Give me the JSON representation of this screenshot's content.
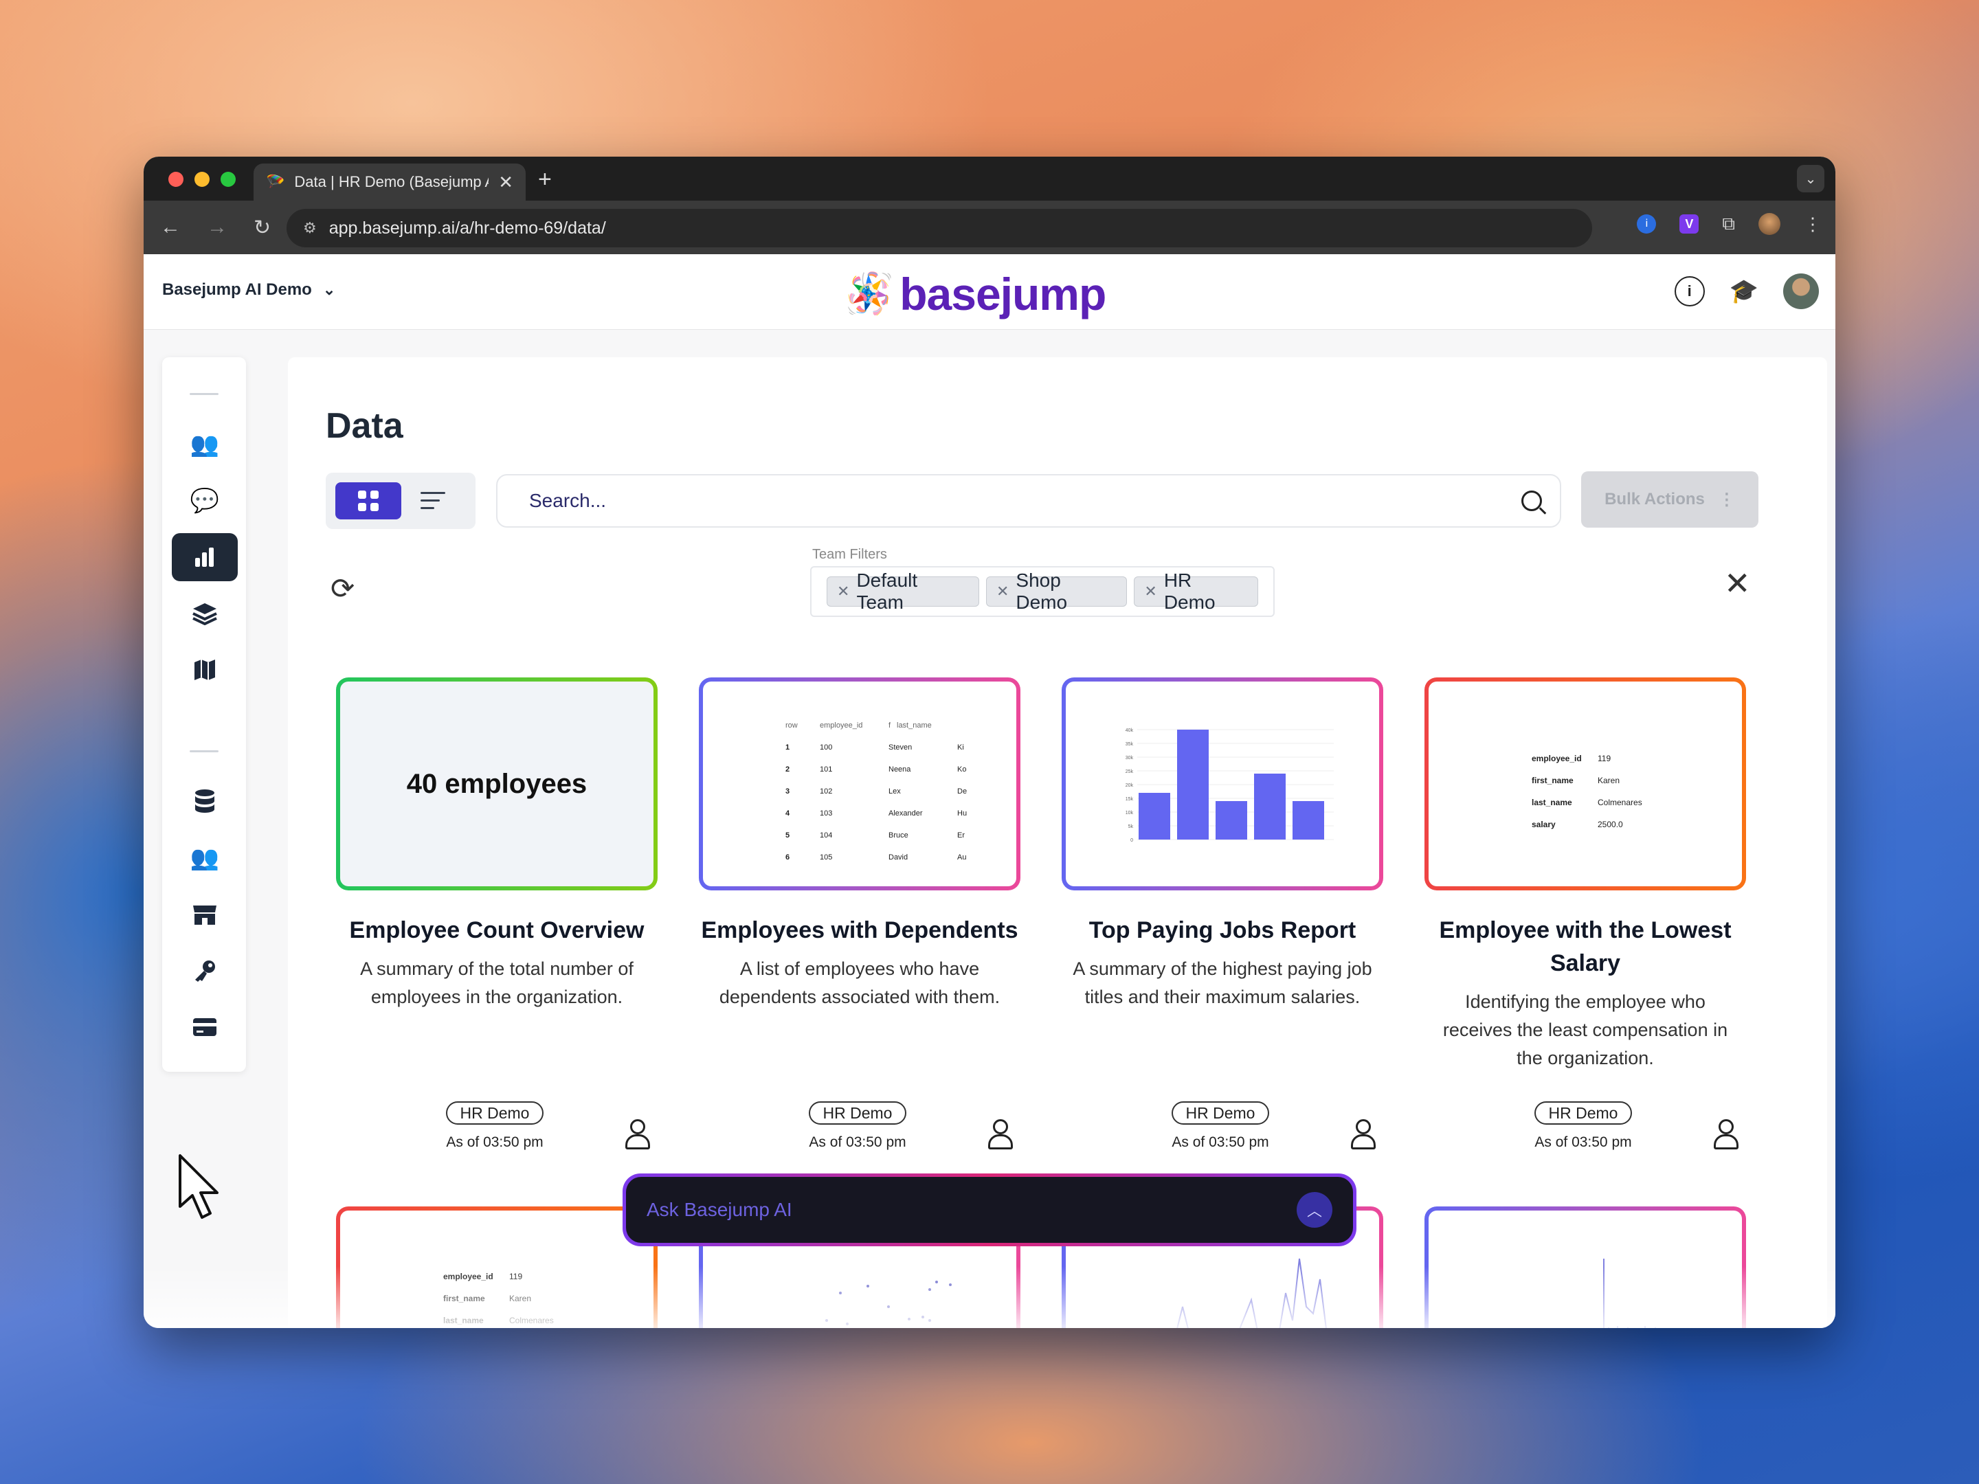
{
  "browser": {
    "tab_title": "Data | HR Demo (Basejump A",
    "tab_favicon": "🪂",
    "url": "app.basejump.ai/a/hr-demo-69/data/",
    "extensions": [
      "password-manager-icon",
      "v-extension-icon",
      "puzzle-icon",
      "profile-avatar",
      "kebab-menu-icon"
    ]
  },
  "header": {
    "workspace": "Basejump AI Demo",
    "logo_text": "basejump",
    "logo_mark": "🪅"
  },
  "sidebar": {
    "items": [
      {
        "name": "teams-icon",
        "glyph": "👥"
      },
      {
        "name": "chat-icon",
        "glyph": "💬"
      },
      {
        "name": "data-icon",
        "glyph": "📊",
        "active": true
      },
      {
        "name": "layers-icon",
        "glyph": "≋"
      },
      {
        "name": "map-icon",
        "glyph": "🗺"
      },
      {
        "name": "database-icon",
        "glyph": "🛢"
      },
      {
        "name": "users-icon",
        "glyph": "👥"
      },
      {
        "name": "store-icon",
        "glyph": "🏪"
      },
      {
        "name": "key-icon",
        "glyph": "🔑"
      },
      {
        "name": "billing-icon",
        "glyph": "💳"
      }
    ]
  },
  "main": {
    "title": "Data",
    "search_placeholder": "Search...",
    "bulk_actions": "Bulk Actions",
    "team_filters_label": "Team Filters",
    "filters": [
      "Default Team",
      "Shop Demo",
      "HR Demo"
    ]
  },
  "cards": [
    {
      "title": "Employee Count Overview",
      "description": "A summary of the total number of employees in the organization.",
      "preview_text": "40 employees",
      "tag": "HR Demo",
      "as_of": "As of 03:50 pm",
      "gradient": [
        "#22c55e",
        "#84cc16"
      ]
    },
    {
      "title": "Employees with Dependents",
      "description": "A list of employees who have dependents associated with them.",
      "tag": "HR Demo",
      "as_of": "As of 03:50 pm",
      "gradient": [
        "#6366f1",
        "#ec4899"
      ],
      "table": {
        "headers": [
          "row",
          "employee_id",
          "f",
          "last_name"
        ],
        "rows": [
          [
            "1",
            "100",
            "Steven",
            "Ki"
          ],
          [
            "2",
            "101",
            "Neena",
            "Ko"
          ],
          [
            "3",
            "102",
            "Lex",
            "De"
          ],
          [
            "4",
            "103",
            "Alexander",
            "Hu"
          ],
          [
            "5",
            "104",
            "Bruce",
            "Er"
          ],
          [
            "6",
            "105",
            "David",
            "Au"
          ]
        ]
      }
    },
    {
      "title": "Top Paying Jobs Report",
      "description": "A summary of the highest paying job titles and their maximum salaries.",
      "tag": "HR Demo",
      "as_of": "As of 03:50 pm",
      "gradient": [
        "#6366f1",
        "#ec4899"
      ]
    },
    {
      "title": "Employee with the Lowest Salary",
      "description": "Identifying the employee who receives the least compensation in the organization.",
      "tag": "HR Demo",
      "as_of": "As of 03:50 pm",
      "gradient": [
        "#ef4444",
        "#f97316"
      ],
      "kv": [
        [
          "employee_id",
          "119"
        ],
        [
          "first_name",
          "Karen"
        ],
        [
          "last_name",
          "Colmenares"
        ],
        [
          "salary",
          "2500.0"
        ]
      ]
    }
  ],
  "chart_data": {
    "type": "bar",
    "categories": [
      "",
      "",
      "",
      "",
      ""
    ],
    "values": [
      17000,
      40000,
      14000,
      24000,
      14000
    ],
    "ylim": [
      0,
      40000
    ],
    "yticks": [
      "0",
      "5k",
      "10k",
      "15k",
      "20k",
      "25k",
      "30k",
      "35k",
      "40k"
    ],
    "color": "#6366f1"
  },
  "second_row": {
    "first_kv": [
      [
        "employee_id",
        "119"
      ],
      [
        "first_name",
        "Karen"
      ],
      [
        "last_name",
        "Colmenares"
      ]
    ]
  },
  "ask": {
    "placeholder": "Ask Basejump AI"
  }
}
